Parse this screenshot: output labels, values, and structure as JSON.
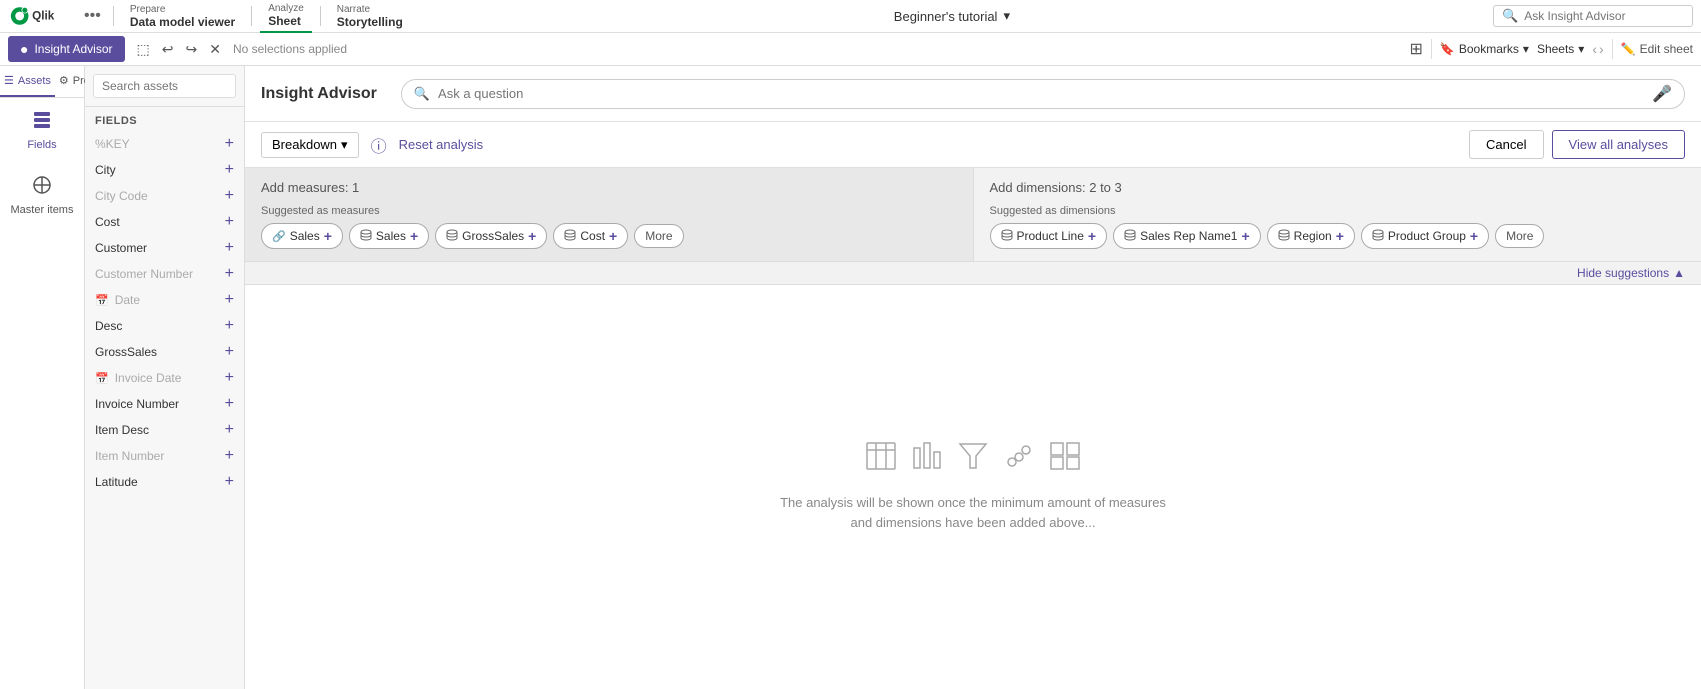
{
  "topNav": {
    "prepare_label": "Prepare",
    "prepare_sub": "Data model viewer",
    "analyze_label": "Analyze",
    "analyze_sub": "Sheet",
    "narrate_label": "Narrate",
    "narrate_sub": "Storytelling",
    "tutorial": "Beginner's tutorial",
    "ask_placeholder": "Ask Insight Advisor",
    "dots": "•••"
  },
  "secondBar": {
    "insight_advisor_tab": "Insight Advisor",
    "no_selections": "No selections applied",
    "bookmarks": "Bookmarks",
    "sheets": "Sheets",
    "edit_sheet": "Edit sheet"
  },
  "leftPanel": {
    "tab_assets": "Assets",
    "tab_properties": "Properties",
    "nav_fields": "Fields",
    "nav_master_items": "Master items"
  },
  "sidebar": {
    "search_placeholder": "Search assets",
    "section_title": "Fields",
    "items": [
      {
        "name": "%KEY",
        "dimmed": true,
        "icon": ""
      },
      {
        "name": "City",
        "dimmed": false,
        "icon": ""
      },
      {
        "name": "City Code",
        "dimmed": true,
        "icon": ""
      },
      {
        "name": "Cost",
        "dimmed": false,
        "icon": ""
      },
      {
        "name": "Customer",
        "dimmed": false,
        "icon": ""
      },
      {
        "name": "Customer Number",
        "dimmed": true,
        "icon": ""
      },
      {
        "name": "Date",
        "dimmed": true,
        "icon": "📅"
      },
      {
        "name": "Desc",
        "dimmed": false,
        "icon": ""
      },
      {
        "name": "GrossSales",
        "dimmed": false,
        "icon": ""
      },
      {
        "name": "Invoice Date",
        "dimmed": true,
        "icon": "📅"
      },
      {
        "name": "Invoice Number",
        "dimmed": false,
        "icon": ""
      },
      {
        "name": "Item Desc",
        "dimmed": false,
        "icon": ""
      },
      {
        "name": "Item Number",
        "dimmed": true,
        "icon": ""
      },
      {
        "name": "Latitude",
        "dimmed": false,
        "icon": ""
      }
    ]
  },
  "contentHeader": {
    "title": "Insight Advisor",
    "search_placeholder": "Ask a question"
  },
  "analysisBar": {
    "breakdown_label": "Breakdown",
    "reset_label": "Reset analysis",
    "cancel_label": "Cancel",
    "view_all_label": "View all analyses"
  },
  "measures": {
    "add_label": "Add measures: 1",
    "suggested_label": "Suggested as measures",
    "chips": [
      {
        "label": "Sales",
        "icon": "🔗"
      },
      {
        "label": "Sales",
        "icon": "🗄️"
      },
      {
        "label": "GrossSales",
        "icon": "🗄️"
      },
      {
        "label": "Cost",
        "icon": "🗄️"
      }
    ],
    "more_label": "More"
  },
  "dimensions": {
    "add_label": "Add dimensions: 2 to 3",
    "suggested_label": "Suggested as dimensions",
    "chips": [
      {
        "label": "Product Line",
        "icon": "🗄️"
      },
      {
        "label": "Sales Rep Name1",
        "icon": "🗄️"
      },
      {
        "label": "Region",
        "icon": "🗄️"
      },
      {
        "label": "Product Group",
        "icon": "🗄️"
      }
    ],
    "more_label": "More"
  },
  "hideSuggestions": {
    "label": "Hide suggestions"
  },
  "mainContent": {
    "placeholder_text_line1": "The analysis will be shown once the minimum amount of measures",
    "placeholder_text_line2": "and dimensions have been added above..."
  }
}
